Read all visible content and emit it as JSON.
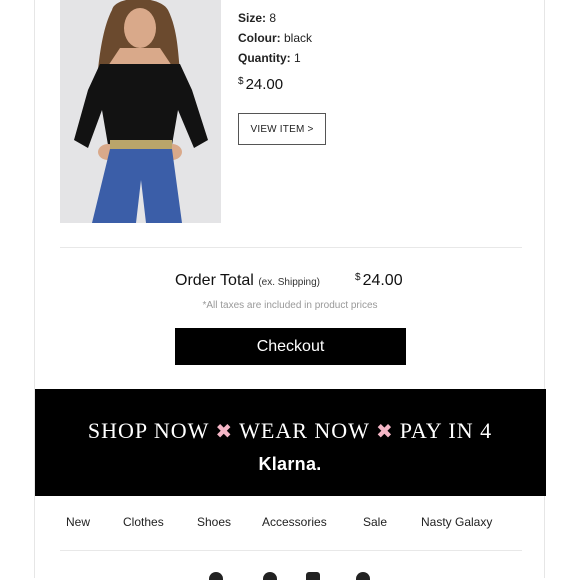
{
  "product": {
    "size_label": "Size:",
    "size_value": "8",
    "colour_label": "Colour:",
    "colour_value": "black",
    "quantity_label": "Quantity:",
    "quantity_value": "1",
    "currency": "$",
    "price": "24.00",
    "view_button": "VIEW ITEM >"
  },
  "order": {
    "total_label": "Order Total",
    "shipping_note": "(ex. Shipping)",
    "currency": "$",
    "total_value": "24.00",
    "tax_note": "*All taxes are included in product prices",
    "checkout_label": "Checkout"
  },
  "banner": {
    "part1": "SHOP NOW",
    "part2": "WEAR NOW",
    "part3": "PAY IN 4",
    "separator": "✖",
    "brand": "Klarna."
  },
  "nav": {
    "items": [
      "New",
      "Clothes",
      "Shoes",
      "Accessories",
      "Sale",
      "Nasty Galaxy"
    ]
  },
  "social_icons": [
    "facebook-icon",
    "twitter-icon",
    "instagram-icon",
    "pinterest-icon"
  ]
}
